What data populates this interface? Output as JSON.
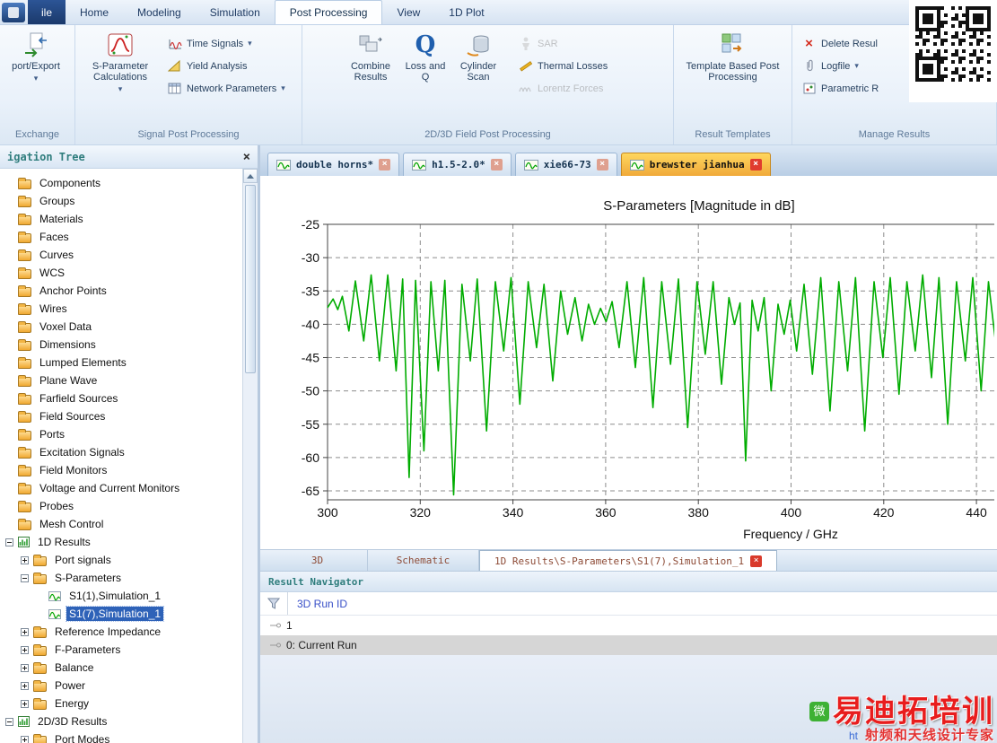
{
  "icons": {
    "close": "×",
    "dropdown": "▾",
    "loss_q_glyph": "Q",
    "delete_glyph": "×"
  },
  "ribbon": {
    "file_tab": "ile",
    "tabs": [
      {
        "label": "Home",
        "active": false
      },
      {
        "label": "Modeling",
        "active": false
      },
      {
        "label": "Simulation",
        "active": false
      },
      {
        "label": "Post Processing",
        "active": true
      },
      {
        "label": "View",
        "active": false
      },
      {
        "label": "1D Plot",
        "active": false
      }
    ],
    "groups": [
      {
        "label": "Exchange"
      },
      {
        "label": "Signal Post Processing"
      },
      {
        "label": "2D/3D Field Post Processing"
      },
      {
        "label": "Result Templates"
      },
      {
        "label": "Manage Results"
      }
    ],
    "buttons": {
      "import_export": "port/Export",
      "sparam_calc": "S-Parameter Calculations",
      "time_signals": "Time Signals",
      "yield_analysis": "Yield Analysis",
      "network_parameters": "Network Parameters",
      "combine_results": "Combine Results",
      "loss_q": "Loss and Q",
      "cylinder_scan": "Cylinder Scan",
      "sar": "SAR",
      "thermal_losses": "Thermal Losses",
      "lorentz_forces": "Lorentz Forces",
      "template_based": "Template Based Post Processing",
      "delete_results": "Delete Resul",
      "logfile": "Logfile",
      "parametric": "Parametric R"
    }
  },
  "nav_tree": {
    "title": "igation Tree",
    "items": [
      {
        "label": "Components",
        "depth": 0,
        "icon": "folder"
      },
      {
        "label": "Groups",
        "depth": 0,
        "icon": "folder"
      },
      {
        "label": "Materials",
        "depth": 0,
        "icon": "folder"
      },
      {
        "label": "Faces",
        "depth": 0,
        "icon": "folder"
      },
      {
        "label": "Curves",
        "depth": 0,
        "icon": "folder"
      },
      {
        "label": "WCS",
        "depth": 0,
        "icon": "folder"
      },
      {
        "label": "Anchor Points",
        "depth": 0,
        "icon": "folder"
      },
      {
        "label": "Wires",
        "depth": 0,
        "icon": "folder"
      },
      {
        "label": "Voxel Data",
        "depth": 0,
        "icon": "folder"
      },
      {
        "label": "Dimensions",
        "depth": 0,
        "icon": "folder"
      },
      {
        "label": "Lumped Elements",
        "depth": 0,
        "icon": "folder"
      },
      {
        "label": "Plane Wave",
        "depth": 0,
        "icon": "folder"
      },
      {
        "label": "Farfield Sources",
        "depth": 0,
        "icon": "folder"
      },
      {
        "label": "Field Sources",
        "depth": 0,
        "icon": "folder"
      },
      {
        "label": "Ports",
        "depth": 0,
        "icon": "folder"
      },
      {
        "label": "Excitation Signals",
        "depth": 0,
        "icon": "folder"
      },
      {
        "label": "Field Monitors",
        "depth": 0,
        "icon": "folder"
      },
      {
        "label": "Voltage and Current Monitors",
        "depth": 0,
        "icon": "folder"
      },
      {
        "label": "Probes",
        "depth": 0,
        "icon": "folder"
      },
      {
        "label": "Mesh Control",
        "depth": 0,
        "icon": "folder"
      },
      {
        "label": "1D Results",
        "depth": 0,
        "icon": "results",
        "expand": "minus"
      },
      {
        "label": "Port signals",
        "depth": 1,
        "icon": "folder",
        "expand": "plus"
      },
      {
        "label": "S-Parameters",
        "depth": 1,
        "icon": "folder",
        "expand": "minus"
      },
      {
        "label": "S1(1),Simulation_1",
        "depth": 2,
        "icon": "signal"
      },
      {
        "label": "S1(7),Simulation_1",
        "depth": 2,
        "icon": "signal",
        "selected": true
      },
      {
        "label": "Reference Impedance",
        "depth": 1,
        "icon": "folder",
        "expand": "plus"
      },
      {
        "label": "F-Parameters",
        "depth": 1,
        "icon": "folder",
        "expand": "plus"
      },
      {
        "label": "Balance",
        "depth": 1,
        "icon": "folder",
        "expand": "plus"
      },
      {
        "label": "Power",
        "depth": 1,
        "icon": "folder",
        "expand": "plus"
      },
      {
        "label": "Energy",
        "depth": 1,
        "icon": "folder",
        "expand": "plus"
      },
      {
        "label": "2D/3D Results",
        "depth": 0,
        "icon": "results",
        "expand": "minus"
      },
      {
        "label": "Port Modes",
        "depth": 1,
        "icon": "folder",
        "expand": "plus"
      }
    ]
  },
  "doc_tabs": [
    {
      "label": "double horns*",
      "active": false
    },
    {
      "label": "h1.5-2.0*",
      "active": false
    },
    {
      "label": "xie66-73",
      "active": false
    },
    {
      "label": "brewster jianhua",
      "active": true
    }
  ],
  "chart_data": {
    "type": "line",
    "title": "S-Parameters [Magnitude in dB]",
    "xlabel": "Frequency / GHz",
    "ylabel": "",
    "xlim": [
      300,
      444
    ],
    "ylim": [
      -66.4,
      -25
    ],
    "xticks": [
      300,
      320,
      340,
      360,
      380,
      400,
      420,
      440
    ],
    "yticks": [
      -25,
      -30,
      -35,
      -40,
      -45,
      -50,
      -55,
      -60,
      -65
    ],
    "grid": true,
    "legend": false,
    "series": [
      {
        "name": "S1(7),Simulation_1",
        "color": "#00ac00",
        "points": [
          [
            300,
            -37.5
          ],
          [
            301.2,
            -36.2
          ],
          [
            302.2,
            -37.8
          ],
          [
            303.2,
            -35.8
          ],
          [
            304.6,
            -41
          ],
          [
            306,
            -33.5
          ],
          [
            307.8,
            -42.5
          ],
          [
            309.4,
            -32.6
          ],
          [
            311.2,
            -45.5
          ],
          [
            313,
            -32.6
          ],
          [
            314.8,
            -47
          ],
          [
            316.2,
            -33.2
          ],
          [
            317.6,
            -63
          ],
          [
            319,
            -33.4
          ],
          [
            320.8,
            -59
          ],
          [
            322.3,
            -33.6
          ],
          [
            323.9,
            -47
          ],
          [
            325.3,
            -33.4
          ],
          [
            327.2,
            -65.6
          ],
          [
            329,
            -34
          ],
          [
            330.8,
            -45.5
          ],
          [
            332.3,
            -33.2
          ],
          [
            334.3,
            -56
          ],
          [
            336.2,
            -33.6
          ],
          [
            338,
            -44
          ],
          [
            339.6,
            -33
          ],
          [
            341.5,
            -52
          ],
          [
            343.3,
            -33.6
          ],
          [
            345.1,
            -43.5
          ],
          [
            346.7,
            -34
          ],
          [
            348.6,
            -48.5
          ],
          [
            350.3,
            -35
          ],
          [
            351.8,
            -41.5
          ],
          [
            353.4,
            -36
          ],
          [
            354.9,
            -42.5
          ],
          [
            356.3,
            -37
          ],
          [
            357.6,
            -40
          ],
          [
            358.9,
            -37.6
          ],
          [
            360.1,
            -39.6
          ],
          [
            361.4,
            -36.6
          ],
          [
            362.9,
            -43.5
          ],
          [
            364.6,
            -33.6
          ],
          [
            366.4,
            -46.5
          ],
          [
            368.2,
            -33
          ],
          [
            370.2,
            -52.5
          ],
          [
            372.1,
            -33.6
          ],
          [
            374,
            -46
          ],
          [
            375.7,
            -33.2
          ],
          [
            377.7,
            -55.5
          ],
          [
            379.7,
            -33.6
          ],
          [
            381.5,
            -44.5
          ],
          [
            383.2,
            -33.6
          ],
          [
            385,
            -49
          ],
          [
            386.6,
            -36
          ],
          [
            387.8,
            -40
          ],
          [
            389,
            -36.8
          ],
          [
            390.2,
            -60.5
          ],
          [
            391.6,
            -36.4
          ],
          [
            392.9,
            -41
          ],
          [
            394.2,
            -36
          ],
          [
            395.7,
            -50
          ],
          [
            397.2,
            -37
          ],
          [
            398.5,
            -41.5
          ],
          [
            399.8,
            -36.4
          ],
          [
            401.2,
            -44
          ],
          [
            402.8,
            -34
          ],
          [
            404.6,
            -47.5
          ],
          [
            406.4,
            -33
          ],
          [
            408.4,
            -53
          ],
          [
            410.3,
            -33.6
          ],
          [
            412.2,
            -47
          ],
          [
            413.9,
            -33
          ],
          [
            415.9,
            -56
          ],
          [
            417.9,
            -33.6
          ],
          [
            419.8,
            -45
          ],
          [
            421.4,
            -33
          ],
          [
            423.3,
            -50.5
          ],
          [
            425,
            -33.6
          ],
          [
            426.8,
            -44
          ],
          [
            428.4,
            -32.6
          ],
          [
            430.3,
            -48
          ],
          [
            431.9,
            -33
          ],
          [
            433.8,
            -55
          ],
          [
            435.7,
            -33.6
          ],
          [
            437.6,
            -45.5
          ],
          [
            439.2,
            -33
          ],
          [
            441,
            -50
          ],
          [
            442.6,
            -33.6
          ],
          [
            444,
            -42
          ]
        ]
      }
    ]
  },
  "bottom_tabs": [
    {
      "label": "3D",
      "active": false,
      "closable": false
    },
    {
      "label": "Schematic",
      "active": false,
      "closable": false
    },
    {
      "label": "1D Results\\S-Parameters\\S1(7),Simulation_1",
      "active": true,
      "closable": true
    }
  ],
  "result_navigator": {
    "title": "Result Navigator",
    "column_header": "3D Run ID",
    "rows": [
      {
        "label": "1",
        "shaded": false
      },
      {
        "label": "0: Current Run",
        "shaded": true
      }
    ]
  },
  "watermark": {
    "wechat_label": "微",
    "title": "易迪拓培训",
    "subtitle": "射频和天线设计专家",
    "url_prefix": "ht"
  }
}
